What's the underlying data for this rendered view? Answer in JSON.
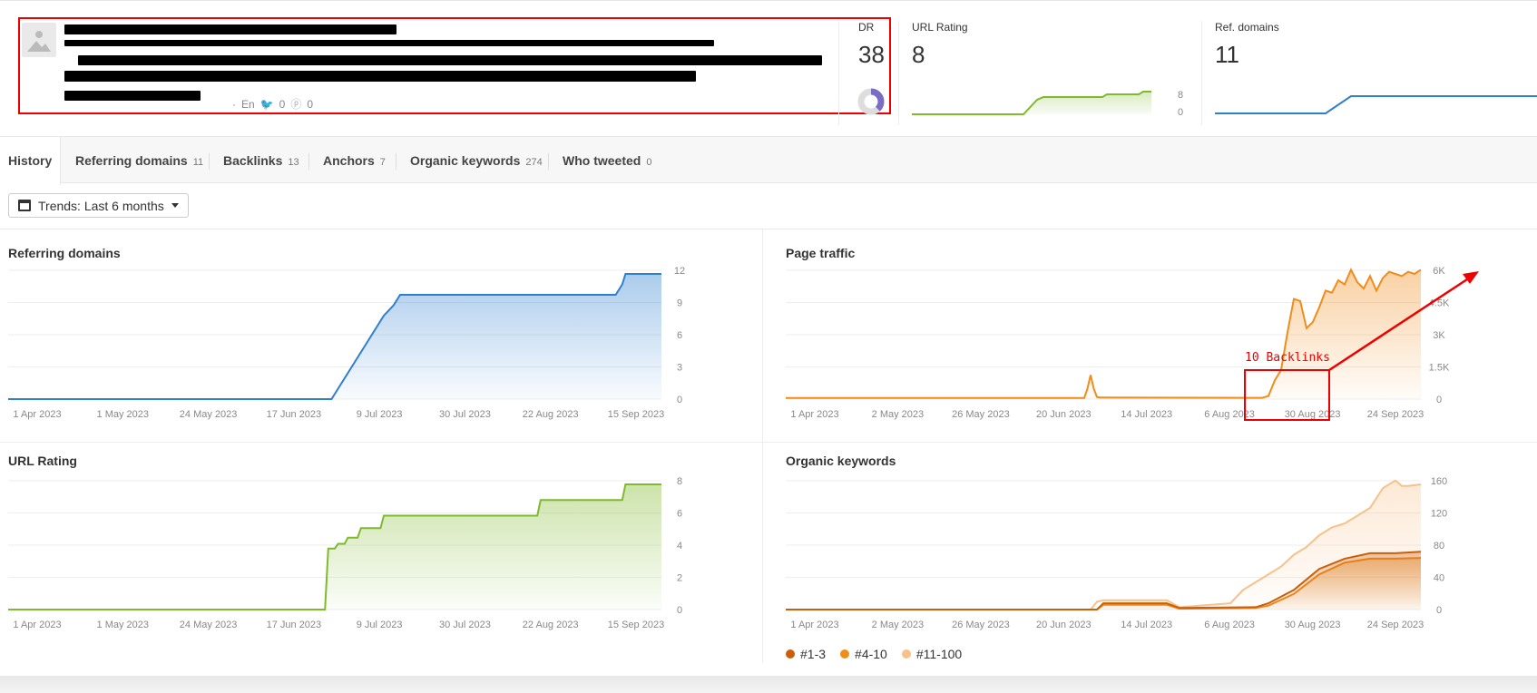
{
  "header": {
    "meta": {
      "lang": "En",
      "twitter_count": "0",
      "pinterest_count": "0"
    },
    "metrics": {
      "dr": {
        "label": "DR",
        "value": "38"
      },
      "ur": {
        "label": "URL Rating",
        "value": "8",
        "axis_top": "8",
        "axis_bottom": "0"
      },
      "rd": {
        "label": "Ref. domains",
        "value": "11"
      }
    }
  },
  "tabs": [
    {
      "label": "History",
      "count": ""
    },
    {
      "label": "Referring domains",
      "count": "11"
    },
    {
      "label": "Backlinks",
      "count": "13"
    },
    {
      "label": "Anchors",
      "count": "7"
    },
    {
      "label": "Organic keywords",
      "count": "274"
    },
    {
      "label": "Who tweeted",
      "count": "0"
    }
  ],
  "trends": {
    "label": "Trends: Last 6 months"
  },
  "annotation": {
    "label": "10 Backlinks",
    "color": "#e00000"
  },
  "colors": {
    "blue": "#2e7fcf",
    "green": "#7fb92c",
    "orange": "#f08c1a",
    "dark_orange": "#c95f0a",
    "light_orange": "#f8c189"
  },
  "chart_data": [
    {
      "id": "referring_domains",
      "type": "area",
      "title": "Referring domains",
      "x_ticks": [
        "1 Apr 2023",
        "1 May 2023",
        "24 May 2023",
        "17 Jun 2023",
        "9 Jul 2023",
        "30 Jul 2023",
        "22 Aug 2023",
        "15 Sep 2023"
      ],
      "y_ticks": [
        "12",
        "9",
        "6",
        "3",
        "0"
      ],
      "ylim": [
        0,
        12
      ],
      "series": [
        {
          "color": "#2e7fcf",
          "x": [
            0,
            0.495,
            0.505,
            0.515,
            0.525,
            0.535,
            0.545,
            0.555,
            0.565,
            0.575,
            0.59,
            0.6,
            0.93,
            0.94,
            0.945,
            1.0
          ],
          "y": [
            0,
            0,
            1,
            2,
            3,
            4,
            5,
            6,
            7,
            8,
            9,
            10,
            10,
            11,
            12,
            12
          ]
        }
      ]
    },
    {
      "id": "page_traffic",
      "type": "area",
      "title": "Page traffic",
      "x_ticks": [
        "1 Apr 2023",
        "2 May 2023",
        "26 May 2023",
        "20 Jun 2023",
        "14 Jul 2023",
        "6 Aug 2023",
        "30 Aug 2023",
        "24 Sep 2023"
      ],
      "y_ticks": [
        "6K",
        "4.5K",
        "3K",
        "1.5K",
        "0"
      ],
      "ylim": [
        0,
        6000
      ],
      "series": [
        {
          "color": "#f08c1a",
          "x": [
            0,
            0.47,
            0.475,
            0.48,
            0.485,
            0.49,
            0.495,
            0.5,
            0.75,
            0.76,
            0.77,
            0.78,
            0.79,
            0.8,
            0.81,
            0.82,
            0.83,
            0.84,
            0.85,
            0.86,
            0.87,
            0.88,
            0.89,
            0.9,
            0.91,
            0.92,
            0.93,
            0.94,
            0.95,
            0.96,
            0.97,
            0.98,
            0.99,
            1.0
          ],
          "y": [
            50,
            50,
            500,
            1150,
            500,
            100,
            80,
            80,
            60,
            150,
            900,
            1400,
            3200,
            4800,
            4700,
            3400,
            3700,
            4400,
            5200,
            5100,
            5700,
            5500,
            6200,
            5600,
            5300,
            5900,
            5200,
            5800,
            6100,
            6000,
            5900,
            6100,
            6000,
            6200
          ]
        }
      ]
    },
    {
      "id": "url_rating",
      "type": "area",
      "title": "URL Rating",
      "x_ticks": [
        "1 Apr 2023",
        "1 May 2023",
        "24 May 2023",
        "17 Jun 2023",
        "9 Jul 2023",
        "30 Jul 2023",
        "22 Aug 2023",
        "15 Sep 2023"
      ],
      "y_ticks": [
        "8",
        "6",
        "4",
        "2",
        "0"
      ],
      "ylim": [
        0,
        8
      ],
      "series": [
        {
          "color": "#7fb92c",
          "x": [
            0,
            0.485,
            0.49,
            0.5,
            0.505,
            0.515,
            0.52,
            0.535,
            0.54,
            0.57,
            0.575,
            0.81,
            0.815,
            0.94,
            0.945,
            1.0
          ],
          "y": [
            0,
            0,
            3.9,
            3.9,
            4.2,
            4.2,
            4.6,
            4.6,
            5.2,
            5.2,
            6.0,
            6.0,
            7.0,
            7.0,
            8.0,
            8.0
          ]
        }
      ]
    },
    {
      "id": "organic_keywords",
      "type": "area",
      "title": "Organic keywords",
      "x_ticks": [
        "1 Apr 2023",
        "2 May 2023",
        "26 May 2023",
        "20 Jun 2023",
        "14 Jul 2023",
        "6 Aug 2023",
        "30 Aug 2023",
        "24 Sep 2023"
      ],
      "y_ticks": [
        "160",
        "120",
        "80",
        "40",
        "0"
      ],
      "ylim": [
        0,
        160
      ],
      "legend": [
        "#1-3",
        "#4-10",
        "#11-100"
      ],
      "series": [
        {
          "name": "#11-100",
          "color": "#f8c189",
          "x": [
            0,
            0.48,
            0.49,
            0.5,
            0.6,
            0.62,
            0.7,
            0.72,
            0.75,
            0.78,
            0.8,
            0.82,
            0.84,
            0.86,
            0.88,
            0.9,
            0.92,
            0.94,
            0.96,
            0.97,
            0.98,
            1.0
          ],
          "y": [
            0,
            0,
            10,
            12,
            12,
            3,
            8,
            25,
            40,
            55,
            70,
            80,
            95,
            105,
            110,
            120,
            130,
            155,
            165,
            158,
            158,
            160
          ]
        },
        {
          "name": "#4-10",
          "color": "#f08c1a",
          "x": [
            0,
            0.49,
            0.5,
            0.6,
            0.62,
            0.74,
            0.76,
            0.8,
            0.84,
            0.88,
            0.92,
            0.96,
            1.0
          ],
          "y": [
            0,
            0,
            6,
            6,
            1,
            2,
            5,
            20,
            45,
            60,
            65,
            65,
            66
          ]
        },
        {
          "name": "#1-3",
          "color": "#c95f0a",
          "x": [
            0,
            0.49,
            0.5,
            0.6,
            0.62,
            0.74,
            0.76,
            0.8,
            0.84,
            0.88,
            0.92,
            0.96,
            1.0
          ],
          "y": [
            0,
            0,
            8,
            8,
            2,
            3,
            8,
            25,
            52,
            65,
            72,
            72,
            74
          ]
        }
      ]
    }
  ]
}
